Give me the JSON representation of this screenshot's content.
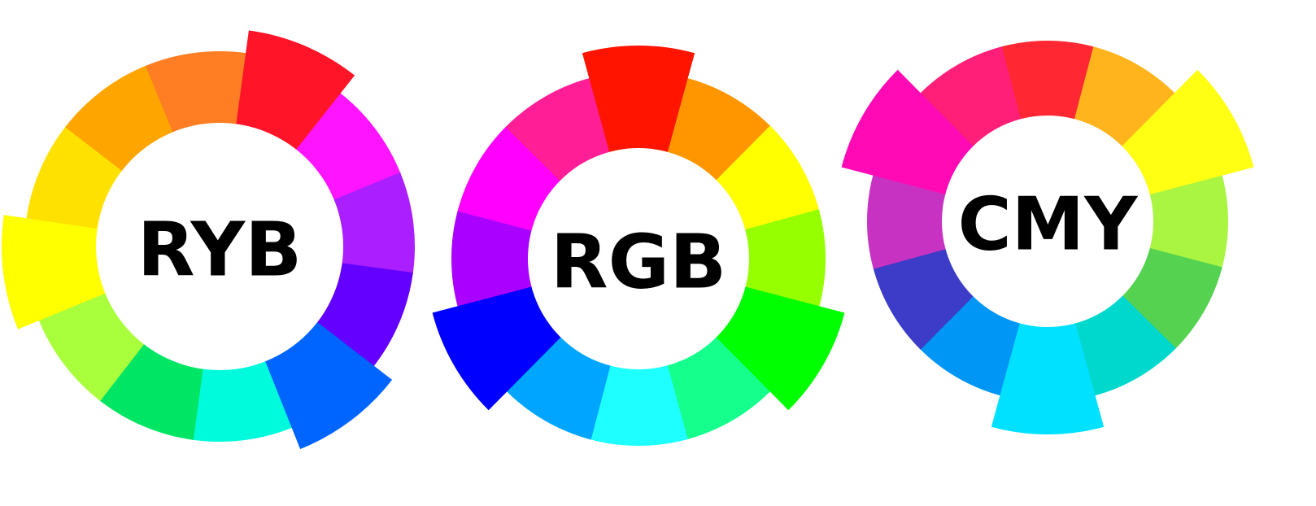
{
  "wheels": [
    {
      "label": "RYB",
      "accented": [
        "red",
        "yellow",
        "blue"
      ],
      "segments": [
        {
          "name": "red",
          "color": "#ff1428"
        },
        {
          "name": "magenta",
          "color": "#ff14ff"
        },
        {
          "name": "violet",
          "color": "#aa1eff"
        },
        {
          "name": "indigo",
          "color": "#6400ff"
        },
        {
          "name": "blue",
          "color": "#0064ff"
        },
        {
          "name": "cyan",
          "color": "#00fadc"
        },
        {
          "name": "green",
          "color": "#00e664"
        },
        {
          "name": "yellow-green",
          "color": "#aaff3c"
        },
        {
          "name": "yellow",
          "color": "#ffff00"
        },
        {
          "name": "gold",
          "color": "#ffe100"
        },
        {
          "name": "orange",
          "color": "#ffa500"
        },
        {
          "name": "red-orange",
          "color": "#ff7d23"
        }
      ]
    },
    {
      "label": "RGB",
      "accented": [
        "red",
        "green",
        "blue"
      ],
      "segments": [
        {
          "name": "red",
          "color": "#ff1400"
        },
        {
          "name": "orange",
          "color": "#ff9600"
        },
        {
          "name": "yellow",
          "color": "#ffff00"
        },
        {
          "name": "chartreuse",
          "color": "#96ff00"
        },
        {
          "name": "green",
          "color": "#00ff00"
        },
        {
          "name": "spring-green",
          "color": "#14ff8c"
        },
        {
          "name": "cyan",
          "color": "#1effff"
        },
        {
          "name": "azure",
          "color": "#00a5ff"
        },
        {
          "name": "blue",
          "color": "#0000ff"
        },
        {
          "name": "violet",
          "color": "#aa00ff"
        },
        {
          "name": "magenta",
          "color": "#ff00ff"
        },
        {
          "name": "rose",
          "color": "#ff1e96"
        }
      ]
    },
    {
      "label": "CMY",
      "accented": [
        "yellow",
        "cyan",
        "magenta"
      ],
      "segments": [
        {
          "name": "red",
          "color": "#ff2832"
        },
        {
          "name": "orange",
          "color": "#ffb41e"
        },
        {
          "name": "yellow",
          "color": "#ffff14"
        },
        {
          "name": "yellow-green",
          "color": "#aaf541"
        },
        {
          "name": "green",
          "color": "#55d250"
        },
        {
          "name": "teal",
          "color": "#00d7cd"
        },
        {
          "name": "cyan",
          "color": "#00e1ff"
        },
        {
          "name": "azure",
          "color": "#0096f5"
        },
        {
          "name": "indigo",
          "color": "#3c3cc8"
        },
        {
          "name": "purple",
          "color": "#c832c3"
        },
        {
          "name": "magenta",
          "color": "#ff0ab4"
        },
        {
          "name": "rose",
          "color": "#ff1e78"
        }
      ]
    }
  ]
}
